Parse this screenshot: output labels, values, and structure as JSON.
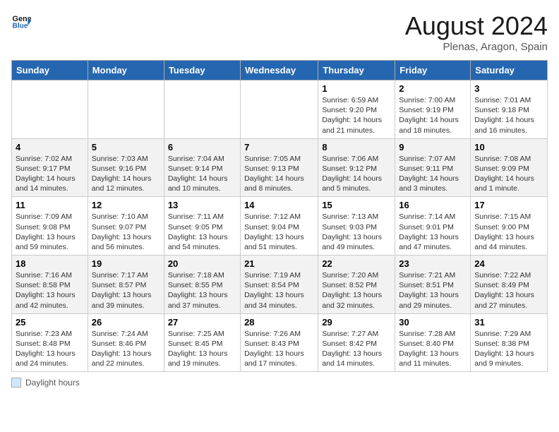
{
  "header": {
    "logo_line1": "General",
    "logo_line2": "Blue",
    "month_title": "August 2024",
    "location": "Plenas, Aragon, Spain"
  },
  "days_of_week": [
    "Sunday",
    "Monday",
    "Tuesday",
    "Wednesday",
    "Thursday",
    "Friday",
    "Saturday"
  ],
  "weeks": [
    [
      {
        "num": "",
        "info": ""
      },
      {
        "num": "",
        "info": ""
      },
      {
        "num": "",
        "info": ""
      },
      {
        "num": "",
        "info": ""
      },
      {
        "num": "1",
        "info": "Sunrise: 6:59 AM\nSunset: 9:20 PM\nDaylight: 14 hours and 21 minutes."
      },
      {
        "num": "2",
        "info": "Sunrise: 7:00 AM\nSunset: 9:19 PM\nDaylight: 14 hours and 18 minutes."
      },
      {
        "num": "3",
        "info": "Sunrise: 7:01 AM\nSunset: 9:18 PM\nDaylight: 14 hours and 16 minutes."
      }
    ],
    [
      {
        "num": "4",
        "info": "Sunrise: 7:02 AM\nSunset: 9:17 PM\nDaylight: 14 hours and 14 minutes."
      },
      {
        "num": "5",
        "info": "Sunrise: 7:03 AM\nSunset: 9:16 PM\nDaylight: 14 hours and 12 minutes."
      },
      {
        "num": "6",
        "info": "Sunrise: 7:04 AM\nSunset: 9:14 PM\nDaylight: 14 hours and 10 minutes."
      },
      {
        "num": "7",
        "info": "Sunrise: 7:05 AM\nSunset: 9:13 PM\nDaylight: 14 hours and 8 minutes."
      },
      {
        "num": "8",
        "info": "Sunrise: 7:06 AM\nSunset: 9:12 PM\nDaylight: 14 hours and 5 minutes."
      },
      {
        "num": "9",
        "info": "Sunrise: 7:07 AM\nSunset: 9:11 PM\nDaylight: 14 hours and 3 minutes."
      },
      {
        "num": "10",
        "info": "Sunrise: 7:08 AM\nSunset: 9:09 PM\nDaylight: 14 hours and 1 minute."
      }
    ],
    [
      {
        "num": "11",
        "info": "Sunrise: 7:09 AM\nSunset: 9:08 PM\nDaylight: 13 hours and 59 minutes."
      },
      {
        "num": "12",
        "info": "Sunrise: 7:10 AM\nSunset: 9:07 PM\nDaylight: 13 hours and 56 minutes."
      },
      {
        "num": "13",
        "info": "Sunrise: 7:11 AM\nSunset: 9:05 PM\nDaylight: 13 hours and 54 minutes."
      },
      {
        "num": "14",
        "info": "Sunrise: 7:12 AM\nSunset: 9:04 PM\nDaylight: 13 hours and 51 minutes."
      },
      {
        "num": "15",
        "info": "Sunrise: 7:13 AM\nSunset: 9:03 PM\nDaylight: 13 hours and 49 minutes."
      },
      {
        "num": "16",
        "info": "Sunrise: 7:14 AM\nSunset: 9:01 PM\nDaylight: 13 hours and 47 minutes."
      },
      {
        "num": "17",
        "info": "Sunrise: 7:15 AM\nSunset: 9:00 PM\nDaylight: 13 hours and 44 minutes."
      }
    ],
    [
      {
        "num": "18",
        "info": "Sunrise: 7:16 AM\nSunset: 8:58 PM\nDaylight: 13 hours and 42 minutes."
      },
      {
        "num": "19",
        "info": "Sunrise: 7:17 AM\nSunset: 8:57 PM\nDaylight: 13 hours and 39 minutes."
      },
      {
        "num": "20",
        "info": "Sunrise: 7:18 AM\nSunset: 8:55 PM\nDaylight: 13 hours and 37 minutes."
      },
      {
        "num": "21",
        "info": "Sunrise: 7:19 AM\nSunset: 8:54 PM\nDaylight: 13 hours and 34 minutes."
      },
      {
        "num": "22",
        "info": "Sunrise: 7:20 AM\nSunset: 8:52 PM\nDaylight: 13 hours and 32 minutes."
      },
      {
        "num": "23",
        "info": "Sunrise: 7:21 AM\nSunset: 8:51 PM\nDaylight: 13 hours and 29 minutes."
      },
      {
        "num": "24",
        "info": "Sunrise: 7:22 AM\nSunset: 8:49 PM\nDaylight: 13 hours and 27 minutes."
      }
    ],
    [
      {
        "num": "25",
        "info": "Sunrise: 7:23 AM\nSunset: 8:48 PM\nDaylight: 13 hours and 24 minutes."
      },
      {
        "num": "26",
        "info": "Sunrise: 7:24 AM\nSunset: 8:46 PM\nDaylight: 13 hours and 22 minutes."
      },
      {
        "num": "27",
        "info": "Sunrise: 7:25 AM\nSunset: 8:45 PM\nDaylight: 13 hours and 19 minutes."
      },
      {
        "num": "28",
        "info": "Sunrise: 7:26 AM\nSunset: 8:43 PM\nDaylight: 13 hours and 17 minutes."
      },
      {
        "num": "29",
        "info": "Sunrise: 7:27 AM\nSunset: 8:42 PM\nDaylight: 13 hours and 14 minutes."
      },
      {
        "num": "30",
        "info": "Sunrise: 7:28 AM\nSunset: 8:40 PM\nDaylight: 13 hours and 11 minutes."
      },
      {
        "num": "31",
        "info": "Sunrise: 7:29 AM\nSunset: 8:38 PM\nDaylight: 13 hours and 9 minutes."
      }
    ]
  ],
  "footer": {
    "legend_label": "Daylight hours"
  }
}
